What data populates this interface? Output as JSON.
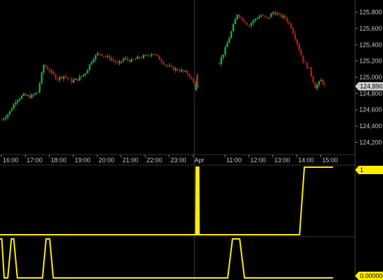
{
  "chart_data": [
    {
      "type": "candlestick",
      "x_ticks": [
        {
          "hour": 16,
          "label": "16:00"
        },
        {
          "hour": 17,
          "label": "17:00"
        },
        {
          "hour": 18,
          "label": "18:00"
        },
        {
          "hour": 19,
          "label": "19:00"
        },
        {
          "hour": 20,
          "label": "20:00"
        },
        {
          "hour": 21,
          "label": "21:00"
        },
        {
          "hour": 22,
          "label": "22:00"
        },
        {
          "hour": 23,
          "label": "23:00"
        },
        {
          "hour": 24,
          "label": "Apr"
        },
        {
          "hour": 35,
          "label": "11:00"
        },
        {
          "hour": 36,
          "label": "12:00"
        },
        {
          "hour": 37,
          "label": "13:00"
        },
        {
          "hour": 38,
          "label": "14:00"
        },
        {
          "hour": 39,
          "label": "15:00"
        }
      ],
      "y_ticks": [
        {
          "value": 124200,
          "label": "124,200"
        },
        {
          "value": 124400,
          "label": "124,400"
        },
        {
          "value": 124600,
          "label": "124,600"
        },
        {
          "value": 124800,
          "label": "124,800"
        },
        {
          "value": 125000,
          "label": "125,000"
        },
        {
          "value": 125200,
          "label": "125,200"
        },
        {
          "value": 125400,
          "label": "125,400"
        },
        {
          "value": 125600,
          "label": "125,600"
        },
        {
          "value": 125800,
          "label": "125,800"
        }
      ],
      "ylim": [
        124050,
        125950
      ],
      "last_price": 124890,
      "last_price_label": "124,890",
      "up_color": "#22a83a",
      "down_color": "#b01818",
      "series": [
        {
          "t": 15.9,
          "c": 124480
        },
        {
          "t": 16.2,
          "c": 124560
        },
        {
          "t": 16.5,
          "c": 124720
        },
        {
          "t": 16.8,
          "c": 124780
        },
        {
          "t": 17.1,
          "c": 124760
        },
        {
          "t": 17.4,
          "c": 124820
        },
        {
          "t": 17.65,
          "c": 125150
        },
        {
          "t": 17.9,
          "c": 125080
        },
        {
          "t": 18.2,
          "c": 124980
        },
        {
          "t": 18.5,
          "c": 125020
        },
        {
          "t": 18.8,
          "c": 124950
        },
        {
          "t": 19.1,
          "c": 124980
        },
        {
          "t": 19.4,
          "c": 125060
        },
        {
          "t": 19.7,
          "c": 125230
        },
        {
          "t": 19.95,
          "c": 125300
        },
        {
          "t": 20.2,
          "c": 125260
        },
        {
          "t": 20.5,
          "c": 125220
        },
        {
          "t": 20.75,
          "c": 125160
        },
        {
          "t": 21.0,
          "c": 125230
        },
        {
          "t": 21.3,
          "c": 125200
        },
        {
          "t": 21.6,
          "c": 125240
        },
        {
          "t": 21.9,
          "c": 125260
        },
        {
          "t": 22.2,
          "c": 125300
        },
        {
          "t": 22.5,
          "c": 125220
        },
        {
          "t": 22.8,
          "c": 125140
        },
        {
          "t": 23.1,
          "c": 125100
        },
        {
          "t": 23.4,
          "c": 125080
        },
        {
          "t": 23.7,
          "c": 125040
        },
        {
          "t": 23.95,
          "c": 124900
        },
        {
          "t": 24.2,
          "c": 124820
        },
        {
          "t": 24.5,
          "c": 124960
        },
        {
          "t": 24.8,
          "c": 125040
        },
        {
          "t": 25.0,
          "c": 124880
        },
        {
          "t": 34.65,
          "c": 125180
        },
        {
          "t": 34.9,
          "c": 125350
        },
        {
          "t": 35.15,
          "c": 125560
        },
        {
          "t": 35.4,
          "c": 125780
        },
        {
          "t": 35.65,
          "c": 125700
        },
        {
          "t": 35.9,
          "c": 125640
        },
        {
          "t": 36.15,
          "c": 125720
        },
        {
          "t": 36.4,
          "c": 125760
        },
        {
          "t": 36.65,
          "c": 125720
        },
        {
          "t": 36.9,
          "c": 125800
        },
        {
          "t": 37.15,
          "c": 125760
        },
        {
          "t": 37.4,
          "c": 125730
        },
        {
          "t": 37.65,
          "c": 125620
        },
        {
          "t": 37.9,
          "c": 125420
        },
        {
          "t": 38.15,
          "c": 125200
        },
        {
          "t": 38.4,
          "c": 125100
        },
        {
          "t": 38.65,
          "c": 124880
        },
        {
          "t": 38.9,
          "c": 124960
        },
        {
          "t": 39.1,
          "c": 124890
        }
      ]
    },
    {
      "type": "line",
      "color": "#ffee00",
      "ylim": [
        0,
        1
      ],
      "last_value_label": "1",
      "x": [
        15.6,
        24.0,
        24.2,
        24.55,
        24.7,
        24.95,
        25.1,
        25.55,
        25.7,
        26.0,
        38.0,
        38.2,
        39.4
      ],
      "y": [
        0,
        0,
        1,
        1,
        0,
        0,
        1,
        1,
        0,
        0,
        0,
        1,
        1
      ]
    },
    {
      "type": "line",
      "color": "#ffee00",
      "ylim": [
        0,
        1
      ],
      "last_value_label": "0.00000",
      "x": [
        15.6,
        15.75,
        15.9,
        16.0,
        16.15,
        16.3,
        16.4,
        16.55,
        16.7,
        17.6,
        17.75,
        17.9,
        18.05,
        18.2,
        35.0,
        35.2,
        35.5,
        35.7,
        39.4
      ],
      "y": [
        0,
        1,
        1,
        0,
        0,
        1,
        1,
        0,
        0,
        0,
        1,
        1,
        0,
        0,
        0,
        1,
        1,
        0,
        0
      ]
    }
  ]
}
